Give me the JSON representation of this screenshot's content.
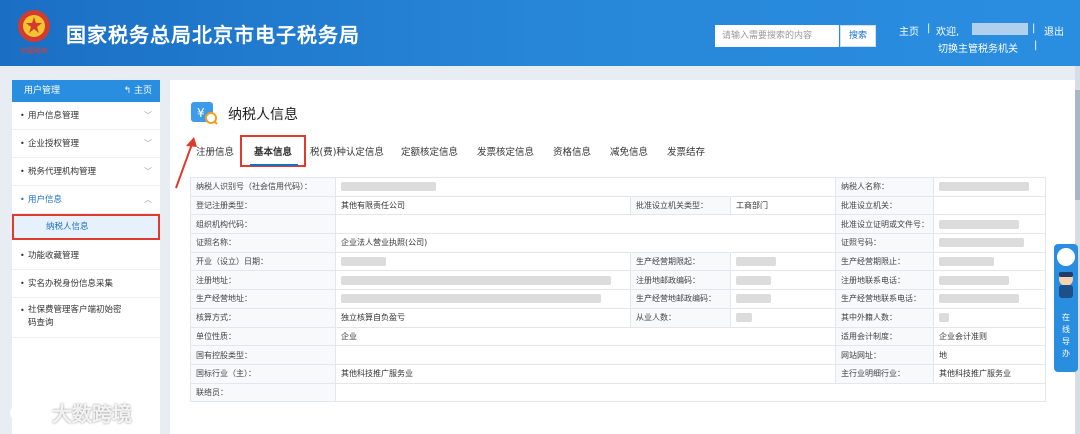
{
  "header": {
    "title": "国家税务总局北京市电子税务局",
    "search_placeholder": "请输入需要搜索的内容",
    "search_button": "搜索",
    "home": "主页",
    "sep": "|",
    "welcome": "欢迎,",
    "logout": "退出",
    "switch": "切换主管税务机关",
    "emblem_text": "中国税务"
  },
  "sidebar": {
    "title": "用户管理",
    "home": "主页",
    "items": [
      {
        "label": "用户信息管理"
      },
      {
        "label": "企业授权管理"
      },
      {
        "label": "税务代理机构管理"
      },
      {
        "label": "用户信息"
      },
      {
        "label": "纳税人信息"
      },
      {
        "label": "功能收藏管理"
      },
      {
        "label": "实名办税身份信息采集"
      },
      {
        "label": "社保费管理客户端初始密码查询"
      }
    ]
  },
  "main": {
    "page_title": "纳税人信息",
    "tabs": [
      {
        "label": "注册信息"
      },
      {
        "label": "基本信息"
      },
      {
        "label": "税(费)种认定信息"
      },
      {
        "label": "定额核定信息"
      },
      {
        "label": "发票核定信息"
      },
      {
        "label": "资格信息"
      },
      {
        "label": "减免信息"
      },
      {
        "label": "发票结存"
      }
    ],
    "table": {
      "r1": {
        "l1": "纳税人识别号（社会信用代码）：",
        "l2": "纳税人名称："
      },
      "r2": {
        "l1": "登记注册类型：",
        "v1": "其他有限责任公司",
        "l2": "批准设立机关类型：",
        "v2": "工商部门",
        "l3": "批准设立机关："
      },
      "r3": {
        "l1": "组织机构代码：",
        "l2": "批准设立证明或文件号："
      },
      "r4": {
        "l1": "证照名称：",
        "v1": "企业法人营业执照(公司)",
        "l2": "证照号码："
      },
      "r5": {
        "l1": "开业（设立）日期：",
        "l2": "生产经营期限起：",
        "l3": "生产经营期限止："
      },
      "r6": {
        "l1": "注册地址：",
        "l2": "注册地邮政编码：",
        "l3": "注册地联系电话："
      },
      "r7": {
        "l1": "生产经营地址：",
        "l2": "生产经营地邮政编码：",
        "l3": "生产经营地联系电话："
      },
      "r8": {
        "l1": "核算方式：",
        "v1": "独立核算自负盈亏",
        "l2": "从业人数：",
        "l3": "其中外籍人数："
      },
      "r9": {
        "l1": "单位性质：",
        "v1": "企业",
        "l2": "适用会计制度：",
        "v2": "企业会计准则"
      },
      "r10": {
        "l1": "国有控股类型：",
        "l2": "网站网址：",
        "v2": "地"
      },
      "r11": {
        "l1": "国标行业（主）：",
        "v1": "其他科技推广服务业",
        "l2": "主行业明细行业：",
        "v2": "其他科技推广服务业"
      },
      "r12": {
        "l1": "联络员："
      }
    }
  },
  "float": {
    "label_1": "在",
    "label_2": "线",
    "label_3": "导",
    "label_4": "办"
  },
  "watermark": "大数跨境",
  "colors": {
    "header_blue": "#2786d8",
    "accent": "#1a6fc4",
    "highlight_red": "#e03a2f"
  }
}
